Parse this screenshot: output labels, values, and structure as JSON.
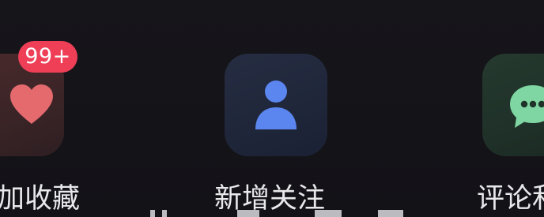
{
  "items": [
    {
      "label": "加收藏",
      "badge": "99+",
      "icon": "heart-icon",
      "accent": "#e46a6e"
    },
    {
      "label": "新增关注",
      "icon": "person-icon",
      "accent": "#5b86ef"
    },
    {
      "label": "评论和",
      "icon": "chat-bubble-icon",
      "accent": "#7fd6a2"
    }
  ],
  "colors": {
    "background": "#141318",
    "badge": "#ee3f57",
    "label": "#e9e9ec"
  }
}
